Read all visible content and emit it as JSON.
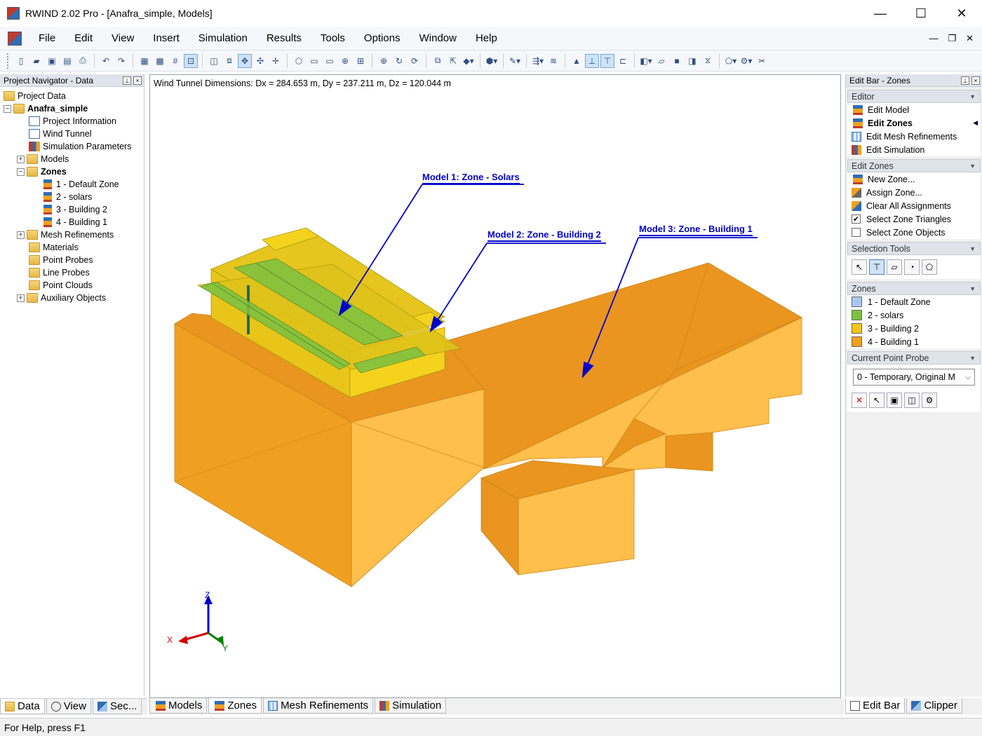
{
  "window": {
    "title": "RWIND 2.02 Pro - [Anafra_simple, Models]",
    "minimize": "—",
    "maximize": "☐",
    "close": "✕"
  },
  "menu": [
    "File",
    "Edit",
    "View",
    "Insert",
    "Simulation",
    "Results",
    "Tools",
    "Options",
    "Window",
    "Help"
  ],
  "mdi_controls": {
    "minimize": "—",
    "restore": "❐",
    "close": "✕"
  },
  "left_panel": {
    "title": "Project Navigator - Data",
    "tree": {
      "root": "Project Data",
      "project": "Anafra_simple",
      "items": [
        "Project Information",
        "Wind Tunnel",
        "Simulation Parameters",
        "Models"
      ],
      "zones_label": "Zones",
      "zones": [
        "1 - Default Zone",
        "2 - solars",
        "3 - Building 2",
        "4 - Building 1"
      ],
      "after": [
        "Mesh Refinements",
        "Materials",
        "Point Probes",
        "Line Probes",
        "Point Clouds",
        "Auxiliary Objects"
      ]
    },
    "tabs": [
      "Data",
      "View",
      "Sec..."
    ]
  },
  "viewport": {
    "info": "Wind Tunnel Dimensions: Dx = 284.653 m, Dy = 237.211 m, Dz = 120.044 m",
    "labels": {
      "model1": "Model 1: Zone - Solars",
      "model2": "Model 2: Zone - Building 2",
      "model3": "Model 3: Zone - Building 1"
    },
    "axes": {
      "x": "X",
      "y": "Y",
      "z": "Z"
    },
    "colors": {
      "building": "#f0a020",
      "building_light": "#ffbf4a",
      "solar_zone": "#e6c51e",
      "solar_panels": "#7cc242",
      "arrow": "#0000c8"
    }
  },
  "bottom_tabs": [
    "Models",
    "Zones",
    "Mesh Refinements",
    "Simulation"
  ],
  "right_panel": {
    "title": "Edit Bar - Zones",
    "editor": {
      "title": "Editor",
      "items": [
        "Edit Model",
        "Edit Zones",
        "Edit Mesh Refinements",
        "Edit Simulation"
      ]
    },
    "edit_zones": {
      "title": "Edit Zones",
      "items": [
        "New Zone...",
        "Assign Zone...",
        "Clear All Assignments"
      ],
      "checks": [
        {
          "label": "Select Zone Triangles",
          "checked": "✔"
        },
        {
          "label": "Select Zone Objects",
          "checked": ""
        }
      ]
    },
    "selection_tools": {
      "title": "Selection Tools"
    },
    "zones": {
      "title": "Zones",
      "items": [
        {
          "label": "1 - Default Zone",
          "color": "#a9c8ef"
        },
        {
          "label": "2 - solars",
          "color": "#7cc242"
        },
        {
          "label": "3 - Building 2",
          "color": "#f5c518"
        },
        {
          "label": "4 - Building 1",
          "color": "#f0a020"
        }
      ]
    },
    "point_probe": {
      "title": "Current Point Probe",
      "value": "0 - Temporary, Original M"
    },
    "tabs": [
      "Edit Bar",
      "Clipper"
    ]
  },
  "status": "For Help, press F1"
}
